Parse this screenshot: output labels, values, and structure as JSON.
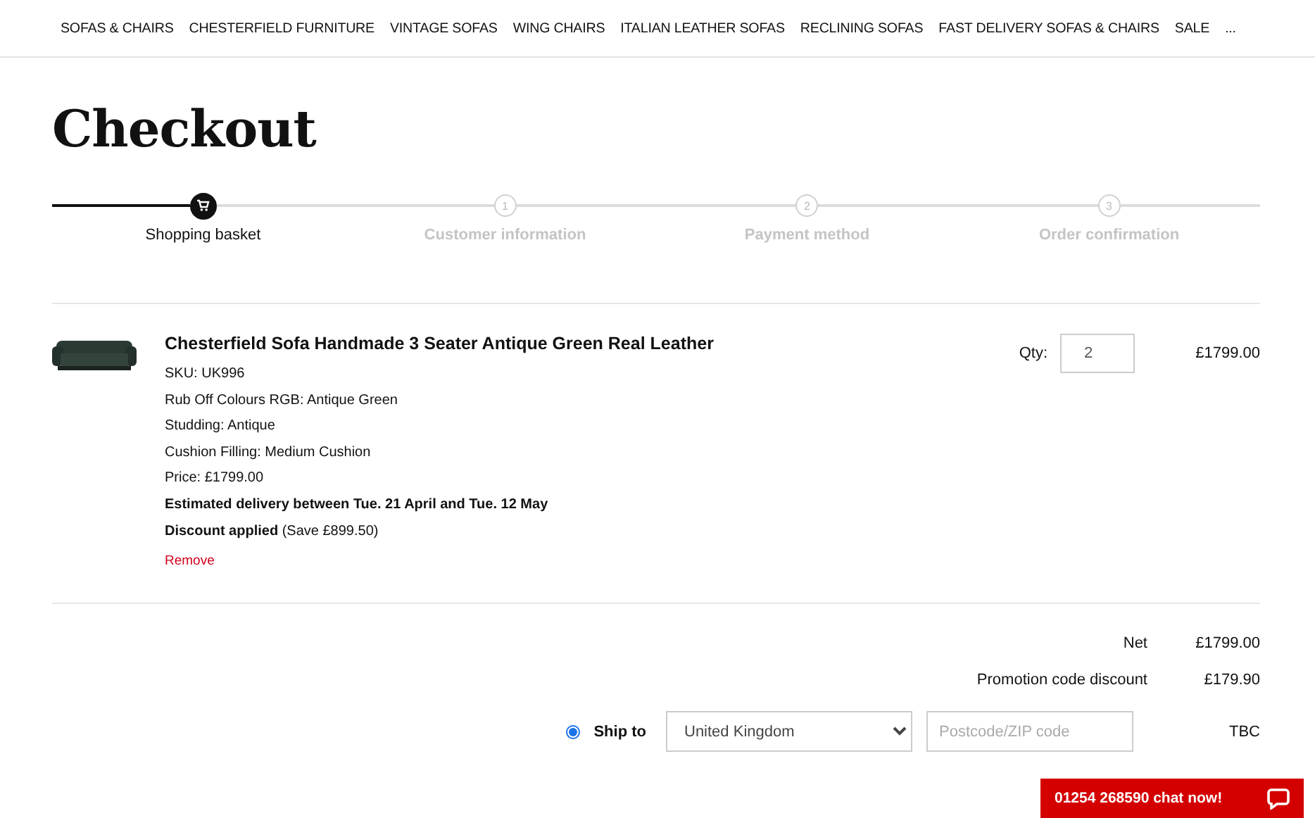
{
  "nav": {
    "items": [
      "SOFAS & CHAIRS",
      "CHESTERFIELD FURNITURE",
      "VINTAGE SOFAS",
      "WING CHAIRS",
      "ITALIAN LEATHER SOFAS",
      "RECLINING SOFAS",
      "FAST DELIVERY SOFAS & CHAIRS",
      "SALE",
      "..."
    ]
  },
  "title": "Checkout",
  "steps": [
    {
      "label": "Shopping basket",
      "selected": true
    },
    {
      "label": "Customer information",
      "marker": "1",
      "selected": false
    },
    {
      "label": "Payment method",
      "marker": "2",
      "selected": false
    },
    {
      "label": "Order confirmation",
      "marker": "3",
      "selected": false
    }
  ],
  "basket": {
    "items": [
      {
        "name": "Chesterfield Sofa Handmade 3 Seater Antique Green Real Leather",
        "details": [
          {
            "text": "SKU: UK996",
            "bold": false
          },
          {
            "text": "Rub Off Colours RGB: Antique Green",
            "bold": false
          },
          {
            "text": "Studding: Antique",
            "bold": false
          },
          {
            "text": "Cushion Filling: Medium Cushion",
            "bold": false
          },
          {
            "text": "Price: £1799.00",
            "bold": false
          },
          {
            "text": "Estimated delivery between Tue. 21 April and Tue. 12 May",
            "bold": true
          },
          {
            "text": "**Discount applied** (Save £899.50)",
            "bold": false
          }
        ],
        "remove": "Remove",
        "qty_label": "Qty:",
        "qty": "2",
        "price": "£1799.00"
      }
    ]
  },
  "totals": [
    {
      "label": "Net",
      "value": "£1799.00"
    },
    {
      "label": "Promotion code discount",
      "value": "£179.90"
    }
  ],
  "shipping": {
    "label": "Ship to",
    "selected": true,
    "country": "United Kingdom",
    "postcode_placeholder": "Postcode/ZIP code",
    "value": "TBC"
  },
  "chat": {
    "label": "01254 268590 chat now!"
  }
}
